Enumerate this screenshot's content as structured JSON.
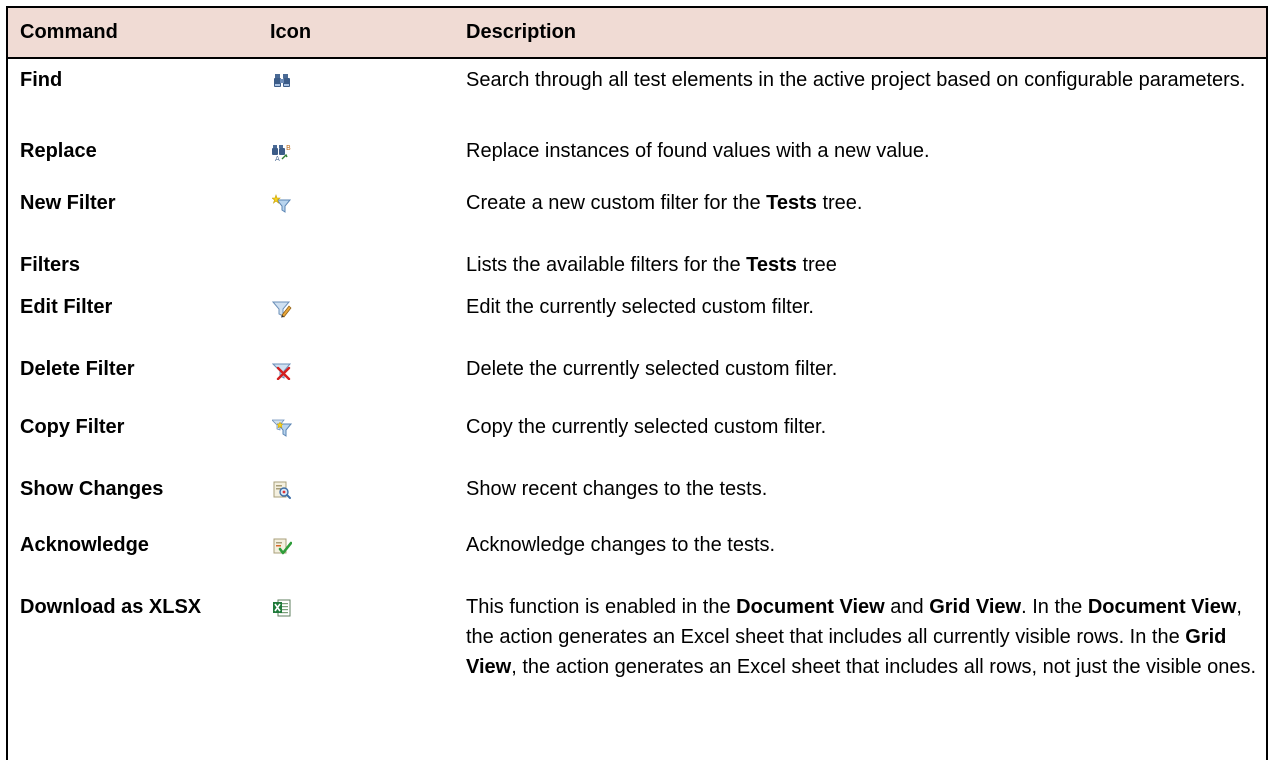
{
  "headers": {
    "command": "Command",
    "icon": "Icon",
    "description": "Description"
  },
  "rows": [
    {
      "command": "Find",
      "icon": "binoculars-icon",
      "desc": [
        "Search through all test elements in the active project based on configurable parameters."
      ]
    },
    {
      "command": "Replace",
      "icon": "binoculars-replace-icon",
      "desc": [
        "Replace instances of found values with a new value."
      ]
    },
    {
      "command": "New Filter",
      "icon": "new-filter-icon",
      "desc": [
        "Create a new custom filter for the ",
        "Tests",
        " tree."
      ]
    },
    {
      "command": "Filters",
      "icon": "",
      "desc": [
        "Lists the available filters for the ",
        "Tests",
        " tree"
      ]
    },
    {
      "command": "Edit Filter",
      "icon": "edit-filter-icon",
      "desc": [
        "Edit the currently selected custom filter."
      ]
    },
    {
      "command": "Delete Filter",
      "icon": "delete-filter-icon",
      "desc": [
        "Delete the currently selected custom filter."
      ]
    },
    {
      "command": "Copy Filter",
      "icon": "copy-filter-icon",
      "desc": [
        "Copy the currently selected custom filter."
      ]
    },
    {
      "command": "Show Changes",
      "icon": "show-changes-icon",
      "desc": [
        "Show recent changes to the tests."
      ]
    },
    {
      "command": "Acknowledge",
      "icon": "acknowledge-icon",
      "desc": [
        "Acknowledge changes to the tests."
      ]
    },
    {
      "command": "Download as XLSX",
      "icon": "excel-icon",
      "desc": [
        "This function is enabled in the ",
        "Document View",
        " and ",
        "Grid View",
        ". In the ",
        "Document View",
        ", the action generates an Excel sheet that includes all currently visible rows. In the ",
        "Grid View",
        ", the action generates an Excel sheet that includes all rows, not just the visible ones."
      ]
    }
  ],
  "colors": {
    "header_bg": "#f0dbd4",
    "border": "#000000"
  }
}
